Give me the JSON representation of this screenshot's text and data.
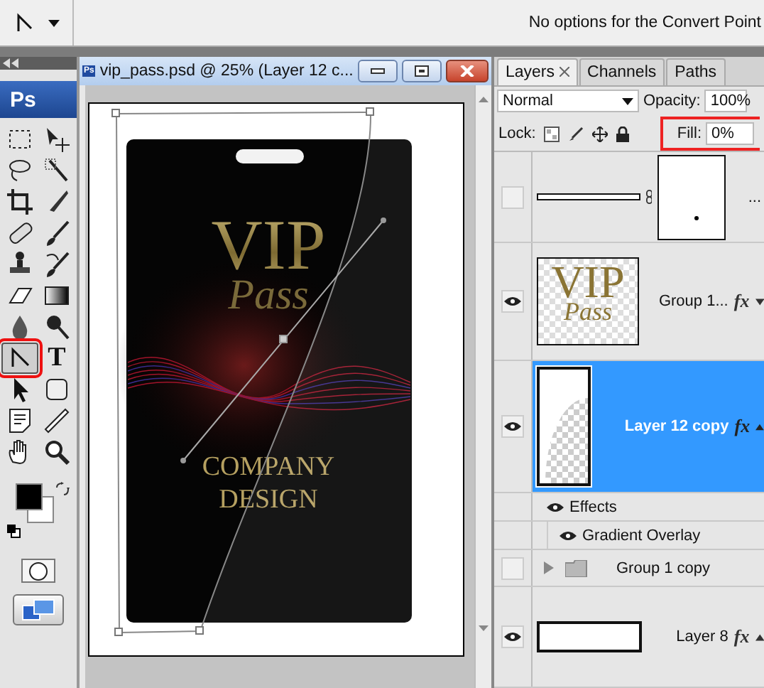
{
  "options_bar": {
    "hint": "No options for the Convert Point"
  },
  "toolbox": {
    "logo": "Ps",
    "tools": [
      {
        "kind": "marquee",
        "selected": false,
        "highlighted": false
      },
      {
        "kind": "move",
        "selected": false,
        "highlighted": false
      },
      {
        "kind": "lasso",
        "selected": false,
        "highlighted": false
      },
      {
        "kind": "wand",
        "selected": false,
        "highlighted": false
      },
      {
        "kind": "crop",
        "selected": false,
        "highlighted": false
      },
      {
        "kind": "slice",
        "selected": false,
        "highlighted": false
      },
      {
        "kind": "heal",
        "selected": false,
        "highlighted": false
      },
      {
        "kind": "brush",
        "selected": false,
        "highlighted": false
      },
      {
        "kind": "stamp",
        "selected": false,
        "highlighted": false
      },
      {
        "kind": "history",
        "selected": false,
        "highlighted": false
      },
      {
        "kind": "eraser",
        "selected": false,
        "highlighted": false
      },
      {
        "kind": "gradient",
        "selected": false,
        "highlighted": false
      },
      {
        "kind": "blur",
        "selected": false,
        "highlighted": false
      },
      {
        "kind": "dodge",
        "selected": false,
        "highlighted": false
      },
      {
        "kind": "pen",
        "selected": true,
        "highlighted": true
      },
      {
        "kind": "type",
        "label": "T",
        "selected": false,
        "highlighted": false
      },
      {
        "kind": "select",
        "selected": false,
        "highlighted": false
      },
      {
        "kind": "shape",
        "selected": false,
        "highlighted": false
      },
      {
        "kind": "notes",
        "selected": false,
        "highlighted": false
      },
      {
        "kind": "eyedropper",
        "selected": false,
        "highlighted": false
      },
      {
        "kind": "hand",
        "selected": false,
        "highlighted": false
      },
      {
        "kind": "zoom",
        "selected": false,
        "highlighted": false
      }
    ]
  },
  "document": {
    "icon": "Ps",
    "title": "vip_pass.psd @ 25% (Layer 12 c...",
    "artwork": {
      "title": "VIP",
      "subtitle": "Pass",
      "line1": "COMPANY",
      "line2": "DESIGN"
    }
  },
  "layers_panel": {
    "tabs": [
      {
        "label": "Layers",
        "selected": true
      },
      {
        "label": "Channels",
        "selected": false
      },
      {
        "label": "Paths",
        "selected": false
      }
    ],
    "blend_mode": "Normal",
    "opacity_label": "Opacity:",
    "opacity": "100%",
    "lock_label": "Lock:",
    "fill_label": "Fill:",
    "fill": "0%",
    "fill_highlighted": true,
    "layers": [
      {
        "kind": "shape",
        "name": "...",
        "visible": false,
        "selected": false
      },
      {
        "kind": "group",
        "name": "Group 1...",
        "visible": true,
        "selected": false,
        "fx": "fx",
        "thumb_text": [
          "VIP",
          "Pass"
        ]
      },
      {
        "kind": "layer",
        "name": "Layer 12 copy",
        "visible": true,
        "selected": true,
        "fx": "fx",
        "effects": {
          "label": "Effects",
          "visible": true,
          "items": [
            {
              "name": "Gradient Overlay",
              "visible": true
            }
          ]
        }
      },
      {
        "kind": "folder",
        "name": "Group 1 copy",
        "visible": false,
        "selected": false,
        "expanded": false
      },
      {
        "kind": "layer",
        "name": "Layer 8",
        "visible": true,
        "selected": false,
        "fx": "fx"
      }
    ]
  }
}
